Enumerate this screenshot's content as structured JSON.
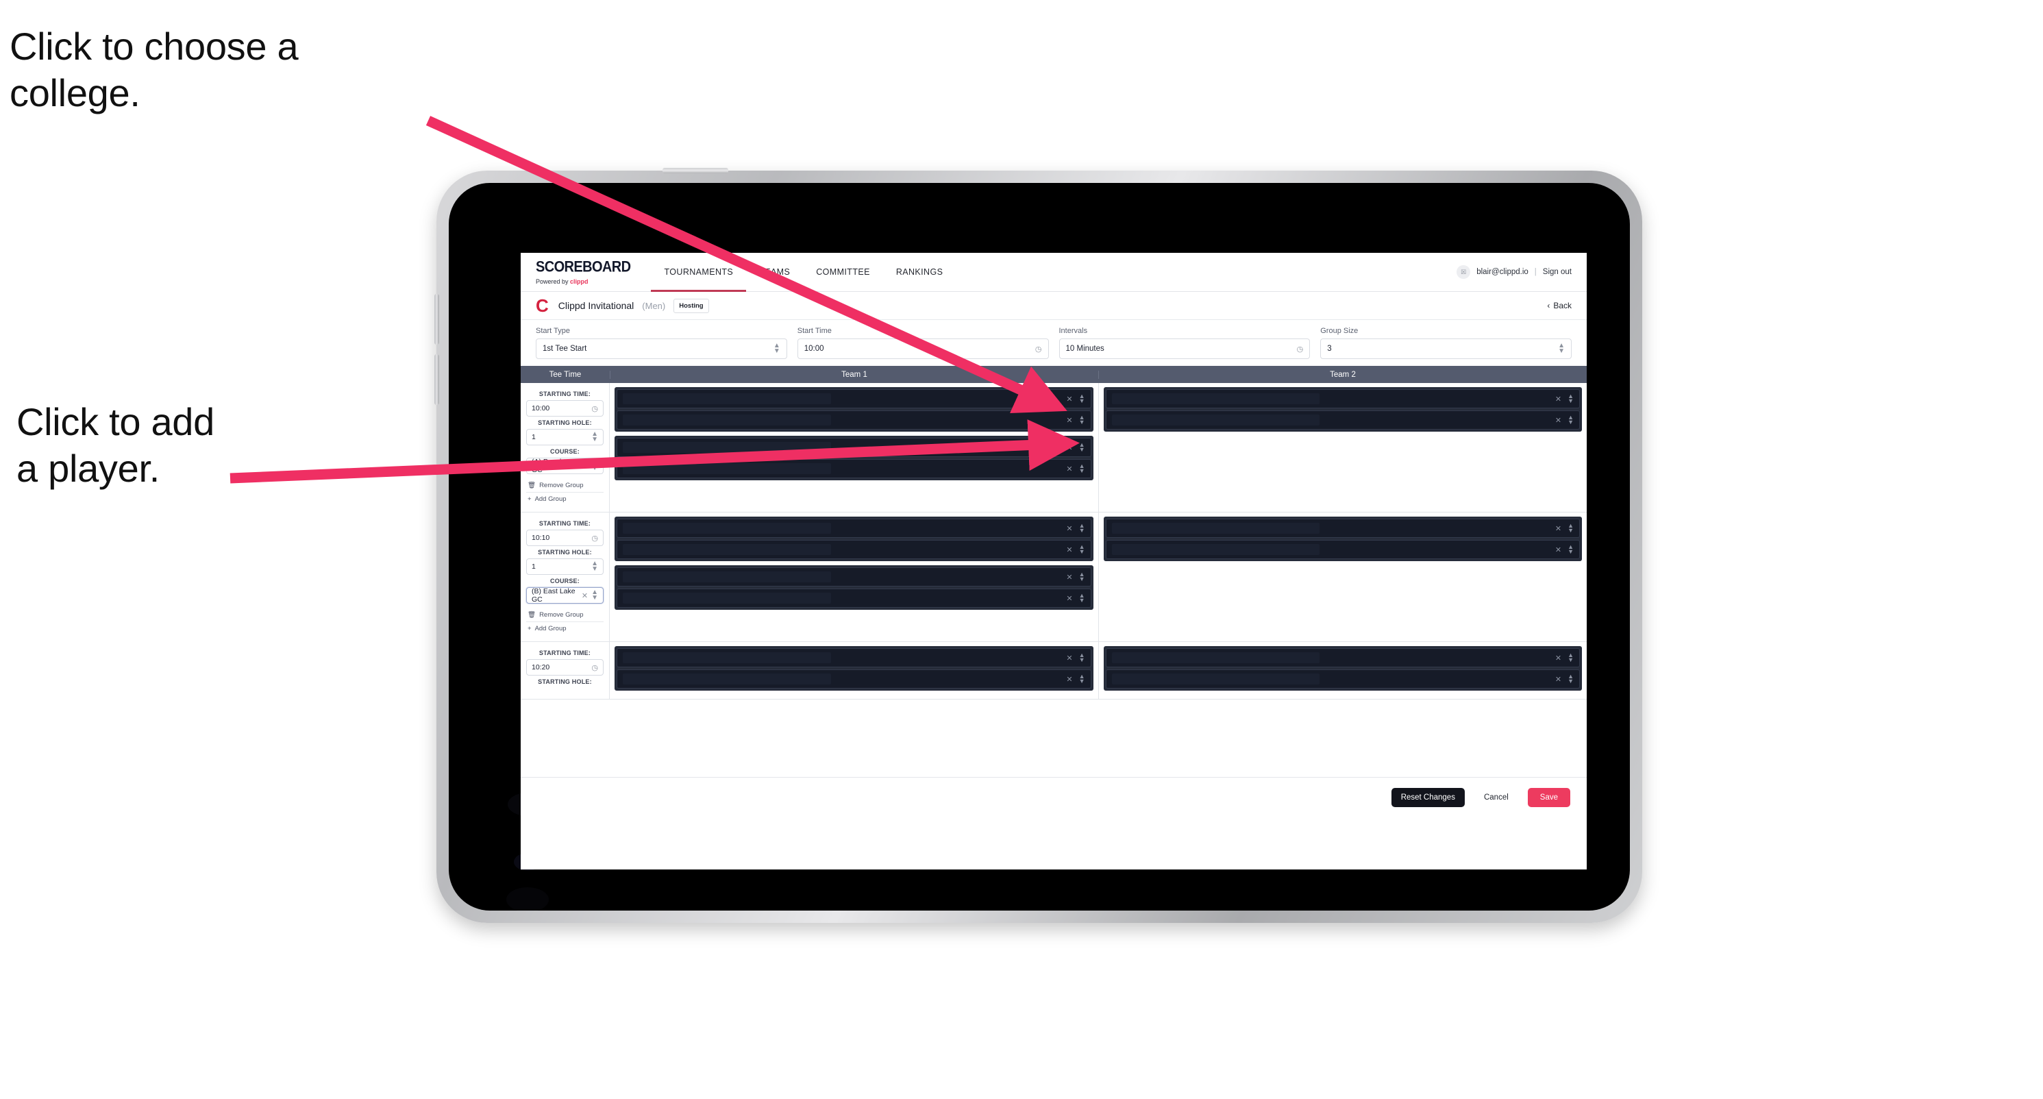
{
  "annotations": [
    {
      "id": "college",
      "text": "Click to choose a\ncollege."
    },
    {
      "id": "player",
      "text": "Click to add\na player."
    }
  ],
  "app": {
    "brand": {
      "title": "SCOREBOARD",
      "powered_prefix": "Powered by ",
      "powered_name": "clippd"
    },
    "nav": {
      "tabs": [
        {
          "label": "TOURNAMENTS",
          "active": true
        },
        {
          "label": "TEAMS",
          "active": false
        },
        {
          "label": "COMMITTEE",
          "active": false
        },
        {
          "label": "RANKINGS",
          "active": false
        }
      ],
      "avatar_glyph": "☒",
      "email": "blair@clippd.io",
      "separator": "|",
      "sign_out": "Sign out"
    },
    "tournament": {
      "logo_letter": "C",
      "name": "Clippd Invitational",
      "gender": "(Men)",
      "badge": "Hosting",
      "back_label": "Back",
      "back_chevron": "‹"
    },
    "controls": [
      {
        "label": "Start Type",
        "value": "1st Tee Start",
        "icon": "stepper-icon"
      },
      {
        "label": "Start Time",
        "value": "10:00",
        "icon": "clock-icon"
      },
      {
        "label": "Intervals",
        "value": "10 Minutes",
        "icon": "clock-icon"
      },
      {
        "label": "Group Size",
        "value": "3",
        "icon": "stepper-icon"
      }
    ],
    "table": {
      "headers": [
        "Tee Time",
        "Team 1",
        "Team 2"
      ],
      "labels": {
        "starting_time": "STARTING TIME:",
        "starting_hole": "STARTING HOLE:",
        "course": "COURSE:",
        "remove_group": "Remove Group",
        "add_group": "Add Group"
      },
      "rows": [
        {
          "starting_time": "10:00",
          "starting_hole": "1",
          "course": "(A) Peachtree GC",
          "course_focused": false,
          "team1_groups": [
            {
              "players": [
                "",
                ""
              ]
            },
            {
              "players": [
                "",
                ""
              ]
            }
          ],
          "team2_groups": [
            {
              "players": [
                "",
                ""
              ]
            }
          ]
        },
        {
          "starting_time": "10:10",
          "starting_hole": "1",
          "course": "(B) East Lake GC",
          "course_focused": true,
          "team1_groups": [
            {
              "players": [
                "",
                ""
              ]
            },
            {
              "players": [
                "",
                ""
              ]
            }
          ],
          "team2_groups": [
            {
              "players": [
                "",
                ""
              ]
            }
          ]
        },
        {
          "starting_time": "10:20",
          "starting_hole": "",
          "course": "",
          "course_focused": false,
          "team1_groups": [
            {
              "players": [
                "",
                ""
              ]
            }
          ],
          "team2_groups": [
            {
              "players": [
                "",
                ""
              ]
            }
          ]
        }
      ]
    },
    "footer": {
      "reset": "Reset Changes",
      "cancel": "Cancel",
      "save": "Save"
    }
  },
  "colors": {
    "accent_pink": "#ed3b5f",
    "annotation_arrow": "#ef2f63",
    "nav_underline": "#c03a55",
    "table_header_bg": "#545b6e",
    "dark_row_bg": "#161b28",
    "group_bg": "#262c3a"
  }
}
